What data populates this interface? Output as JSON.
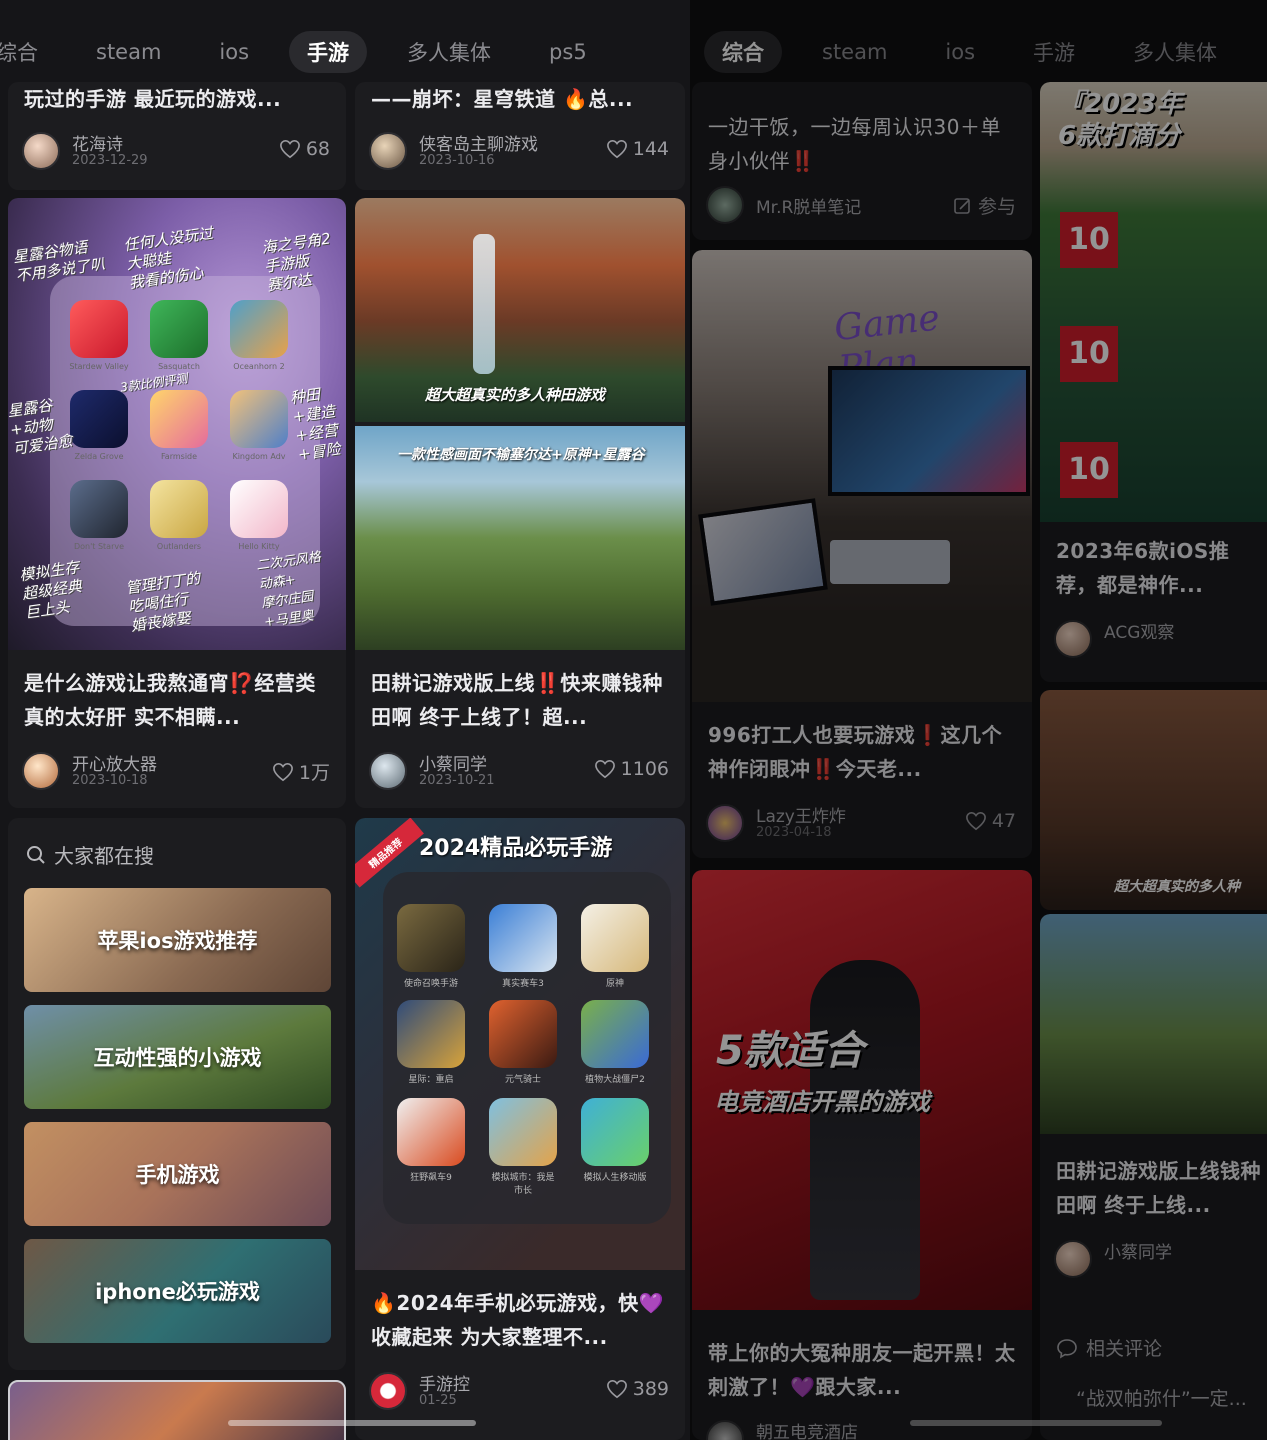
{
  "left": {
    "tabs": [
      {
        "label": "综合",
        "active": false
      },
      {
        "label": "steam",
        "active": false
      },
      {
        "label": "ios",
        "active": false
      },
      {
        "label": "手游",
        "active": true
      },
      {
        "label": "多人集体",
        "active": false
      },
      {
        "label": "ps5",
        "active": false
      }
    ],
    "col1": {
      "top_card": {
        "title": "玩过的手游 最近玩的游戏...",
        "author": "花海诗",
        "date": "2023-12-29",
        "likes": "68"
      },
      "mid_card": {
        "annotations": [
          "星露谷物语\n不用多说了叭",
          "任何人没玩过\n大聪娃\n我看的伤心",
          "海之号角2\n手游版\n赛尔达",
          "3款比例评测\n",
          "星露谷\n+动物\n可爱治愈",
          "种田\n+建造\n+经营\n+冒险",
          "模拟生存\n超级经典\n巨上头",
          "管理打丁的\n吃喝住行\n婚丧嫁娶",
          "二次元风格\n动森+\n摩尔庄园\n+马里奥"
        ],
        "app_labels": [
          "Stardew Valley",
          "Sasquatch",
          "Oceanhorn 2",
          "Zelda Grove",
          "Farmside",
          "Kingdom Adv",
          "Don't Starve",
          "Outlanders",
          "Hello Kitty"
        ],
        "title": "是什么游戏让我熬通宵⁉️经营类真的太好肝 实不相瞒...",
        "author": "开心放大器",
        "date": "2023-10-18",
        "likes": "1万"
      },
      "search": {
        "heading": "大家都在搜",
        "items": [
          "苹果ios游戏推荐",
          "互动性强的小游戏",
          "手机游戏",
          "iphone必玩游戏"
        ]
      }
    },
    "col2": {
      "top_card": {
        "title": "——崩坏：星穹铁道 🔥总...",
        "author": "侠客岛主聊游戏",
        "date": "2023-10-16",
        "likes": "144"
      },
      "mid_card": {
        "banner_top": "超大超真实的多人种田游戏",
        "banner_bottom": "一款性感画面不输塞尔达+原神+星露谷",
        "title": "田耕记游戏版上线‼️快来赚钱种田啊 终于上线了！超...",
        "author": "小蔡同学",
        "date": "2023-10-21",
        "likes": "1106"
      },
      "bottom_card": {
        "ribbon": "精品推荐",
        "header": "2024精品必玩手游",
        "app_labels": [
          "使命召唤手游",
          "真实赛车3",
          "原神",
          "星际：重启",
          "元气骑士",
          "植物大战僵尸2",
          "狂野飙车9",
          "模拟城市：我是市长",
          "模拟人生移动版"
        ],
        "title": "🔥2024年手机必玩游戏，快💜收藏起来 为大家整理不...",
        "author": "手游控",
        "date": "01-25",
        "likes": "389"
      }
    }
  },
  "right": {
    "tabs": [
      {
        "label": "综合",
        "active": true
      },
      {
        "label": "steam",
        "active": false
      },
      {
        "label": "ios",
        "active": false
      },
      {
        "label": "手游",
        "active": false
      },
      {
        "label": "多人集体",
        "active": false
      }
    ],
    "col1": {
      "top_card": {
        "title": "一边干饭，一边每周认识30＋单身小伙伴‼️",
        "author": "Mr.R脱单笔记",
        "action": "参与"
      },
      "desk_card": {
        "neon": "Game Plan",
        "title": "996打工人也要玩游戏❗️这几个神作闭眼冲‼️今天老...",
        "author": "Lazy王炸炸",
        "date": "2023-04-18",
        "likes": "47"
      },
      "hero_card": {
        "line1": "5款适合",
        "line2": "电竞酒店开黑的游戏",
        "title": "带上你的大冤种朋友一起开黑！太刺激了！💜跟大家...",
        "author": "朝五电竞酒店"
      }
    },
    "col2": {
      "top_text": "『2023年\n6款打滴分",
      "badges": [
        "10",
        "10",
        "10"
      ],
      "mid_title": "2023年6款iOS推荐，都是神作...",
      "mid_author": "ACG观察",
      "mid_banner": "超大超真实的多人种",
      "lower_title": "田耕记游戏版上线钱种田啊 终于上线...",
      "lower_author": "小蔡同学",
      "comment_label": "相关评论",
      "comment_text": "“战双帕弥什”一定..."
    }
  }
}
